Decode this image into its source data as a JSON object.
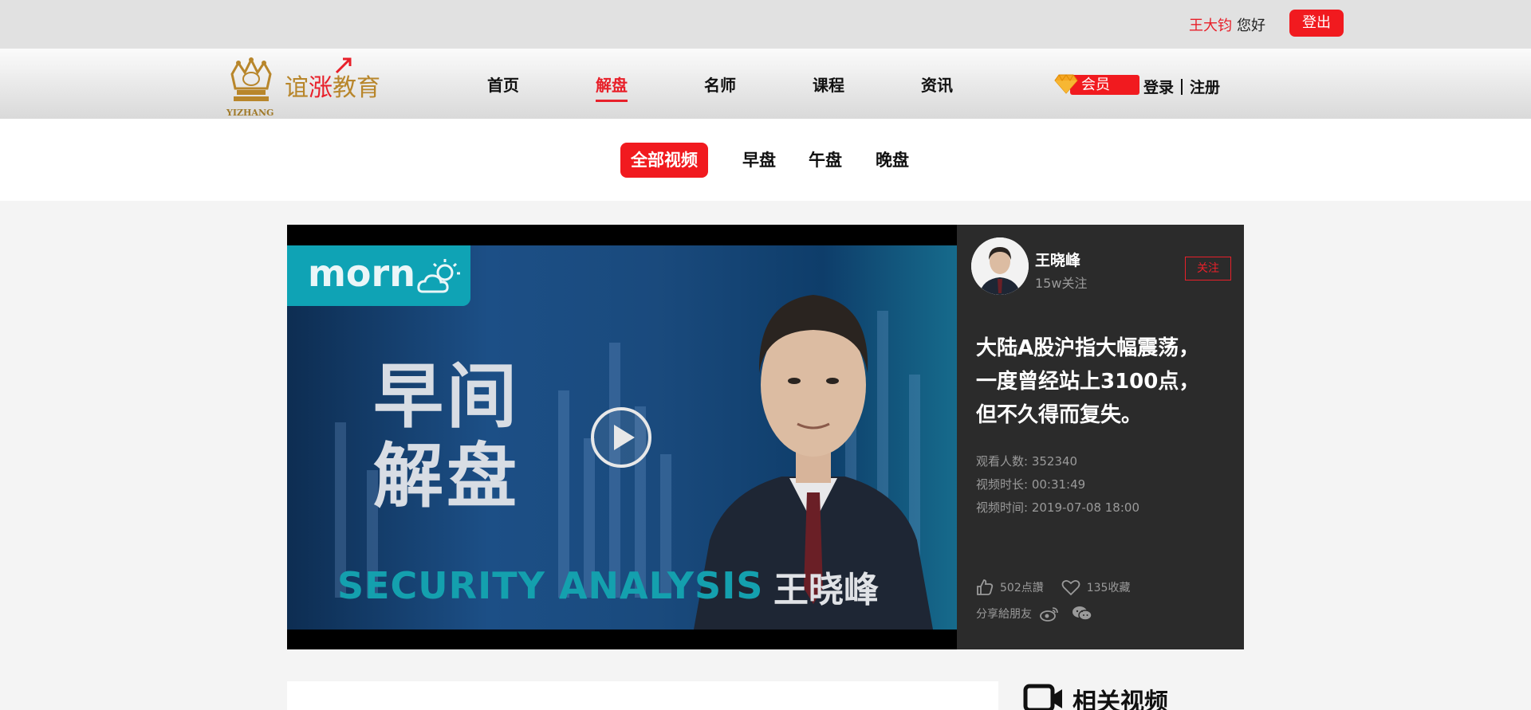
{
  "topbar": {
    "user_name": "王大钧",
    "greeting": "您好",
    "logout_label": "登出"
  },
  "logo": {
    "text_pre": "谊",
    "text_zhang": "涨",
    "text_post": "教育",
    "subtitle": "YIZHANG"
  },
  "nav": {
    "items": [
      {
        "label": "首页"
      },
      {
        "label": "解盘"
      },
      {
        "label": "名师"
      },
      {
        "label": "课程"
      },
      {
        "label": "资讯"
      }
    ],
    "active": "解盘",
    "member_label": "会员",
    "login_label": "登录",
    "register_label": "注册"
  },
  "subtabs": {
    "items": [
      "全部视频",
      "早盘",
      "午盘",
      "晚盘"
    ],
    "active": "全部视频"
  },
  "video": {
    "badge_word": "morn",
    "title_line1": "早间",
    "title_line2": "解盘",
    "english": "SECURITY ANALYSIS",
    "presenter": "王晓峰"
  },
  "teacher": {
    "name": "王晓峰",
    "followers": "15w关注",
    "follow_label": "关注"
  },
  "info": {
    "headline_lines": [
      "大陆A股沪指大幅震荡，",
      "一度曾经站上3100点，",
      "但不久得而复失。"
    ],
    "viewers": "观看人数: 352340",
    "duration": "视频时长: 00:31:49",
    "time": "视频时间: 2019-07-08 18:00",
    "likes": "502点讚",
    "favorites": "135收藏",
    "share_label": "分享給朋友"
  },
  "related": {
    "label": "相关视频"
  },
  "colors": {
    "accent": "#f11a1f",
    "panel": "#2b2b2b",
    "teal": "#14a0ae"
  }
}
